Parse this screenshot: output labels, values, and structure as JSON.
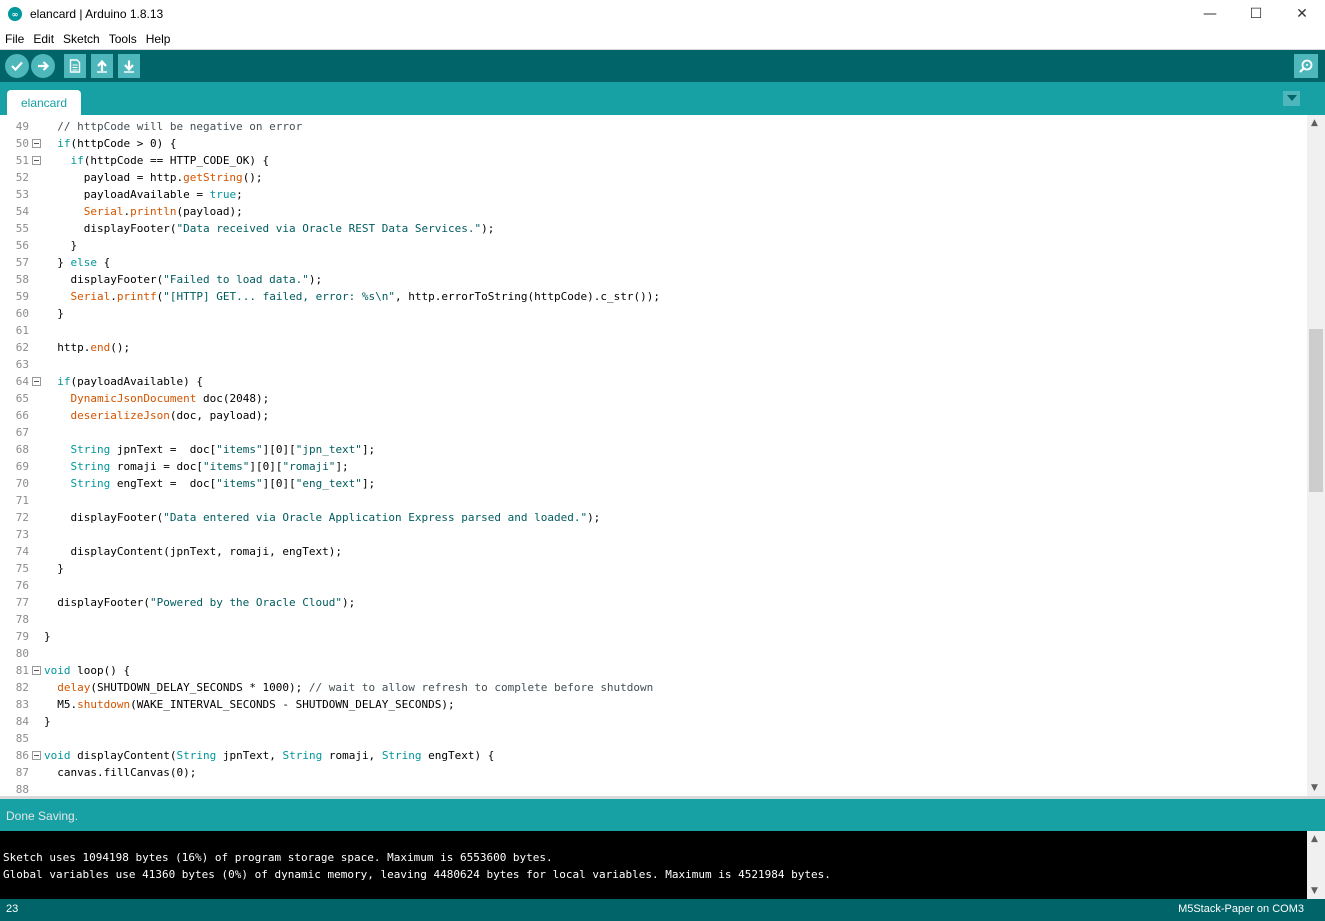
{
  "window": {
    "title": "elancard | Arduino 1.8.13",
    "minimize": "—",
    "maximize": "☐",
    "close": "✕"
  },
  "menu": [
    "File",
    "Edit",
    "Sketch",
    "Tools",
    "Help"
  ],
  "toolbar": {
    "verify_icon": "check-icon",
    "upload_icon": "arrow-right-icon",
    "new_icon": "new-file-icon",
    "open_icon": "arrow-up-icon",
    "save_icon": "arrow-down-icon",
    "serial_icon": "magnifier-icon"
  },
  "tab": {
    "label": "elancard"
  },
  "colors": {
    "toolbar": "#006468",
    "tabbar": "#17a1a5",
    "keyword": "#00979c",
    "function": "#d35400",
    "string": "#005c5f"
  },
  "code": [
    {
      "n": "49",
      "fold": false,
      "t": "  // httpCode will be negative on error"
    },
    {
      "n": "50",
      "fold": true,
      "t": "  if(httpCode > 0) {"
    },
    {
      "n": "51",
      "fold": true,
      "t": "    if(httpCode == HTTP_CODE_OK) {"
    },
    {
      "n": "52",
      "fold": false,
      "t": "      payload = http.getString();"
    },
    {
      "n": "53",
      "fold": false,
      "t": "      payloadAvailable = true;"
    },
    {
      "n": "54",
      "fold": false,
      "t": "      Serial.println(payload);"
    },
    {
      "n": "55",
      "fold": false,
      "t": "      displayFooter(\"Data received via Oracle REST Data Services.\");"
    },
    {
      "n": "56",
      "fold": false,
      "t": "    }"
    },
    {
      "n": "57",
      "fold": false,
      "t": "  } else {"
    },
    {
      "n": "58",
      "fold": false,
      "t": "    displayFooter(\"Failed to load data.\");"
    },
    {
      "n": "59",
      "fold": false,
      "t": "    Serial.printf(\"[HTTP] GET... failed, error: %s\\n\", http.errorToString(httpCode).c_str());"
    },
    {
      "n": "60",
      "fold": false,
      "t": "  }"
    },
    {
      "n": "61",
      "fold": false,
      "t": ""
    },
    {
      "n": "62",
      "fold": false,
      "t": "  http.end();"
    },
    {
      "n": "63",
      "fold": false,
      "t": ""
    },
    {
      "n": "64",
      "fold": true,
      "t": "  if(payloadAvailable) {"
    },
    {
      "n": "65",
      "fold": false,
      "t": "    DynamicJsonDocument doc(2048);"
    },
    {
      "n": "66",
      "fold": false,
      "t": "    deserializeJson(doc, payload);"
    },
    {
      "n": "67",
      "fold": false,
      "t": ""
    },
    {
      "n": "68",
      "fold": false,
      "t": "    String jpnText =  doc[\"items\"][0][\"jpn_text\"];"
    },
    {
      "n": "69",
      "fold": false,
      "t": "    String romaji = doc[\"items\"][0][\"romaji\"];"
    },
    {
      "n": "70",
      "fold": false,
      "t": "    String engText =  doc[\"items\"][0][\"eng_text\"];"
    },
    {
      "n": "71",
      "fold": false,
      "t": ""
    },
    {
      "n": "72",
      "fold": false,
      "t": "    displayFooter(\"Data entered via Oracle Application Express parsed and loaded.\");"
    },
    {
      "n": "73",
      "fold": false,
      "t": ""
    },
    {
      "n": "74",
      "fold": false,
      "t": "    displayContent(jpnText, romaji, engText);"
    },
    {
      "n": "75",
      "fold": false,
      "t": "  }"
    },
    {
      "n": "76",
      "fold": false,
      "t": ""
    },
    {
      "n": "77",
      "fold": false,
      "t": "  displayFooter(\"Powered by the Oracle Cloud\");"
    },
    {
      "n": "78",
      "fold": false,
      "t": ""
    },
    {
      "n": "79",
      "fold": false,
      "t": "}"
    },
    {
      "n": "80",
      "fold": false,
      "t": ""
    },
    {
      "n": "81",
      "fold": true,
      "t": "void loop() {"
    },
    {
      "n": "82",
      "fold": false,
      "t": "  delay(SHUTDOWN_DELAY_SECONDS * 1000); // wait to allow refresh to complete before shutdown"
    },
    {
      "n": "83",
      "fold": false,
      "t": "  M5.shutdown(WAKE_INTERVAL_SECONDS - SHUTDOWN_DELAY_SECONDS);"
    },
    {
      "n": "84",
      "fold": false,
      "t": "}"
    },
    {
      "n": "85",
      "fold": false,
      "t": ""
    },
    {
      "n": "86",
      "fold": true,
      "t": "void displayContent(String jpnText, String romaji, String engText) {"
    },
    {
      "n": "87",
      "fold": false,
      "t": "  canvas.fillCanvas(0);"
    },
    {
      "n": "88",
      "fold": false,
      "t": ""
    }
  ],
  "status": {
    "message": "Done Saving."
  },
  "console": [
    "Sketch uses 1094198 bytes (16%) of program storage space. Maximum is 6553600 bytes.",
    "Global variables use 41360 bytes (0%) of dynamic memory, leaving 4480624 bytes for local variables. Maximum is 4521984 bytes."
  ],
  "footer": {
    "line": "23",
    "board": "M5Stack-Paper on COM3"
  }
}
